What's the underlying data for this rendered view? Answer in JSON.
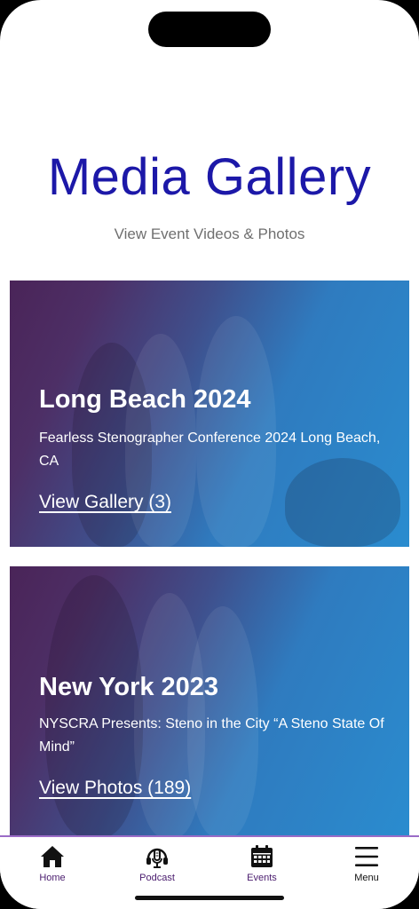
{
  "header": {
    "title": "Media Gallery",
    "subtitle": "View Event Videos & Photos"
  },
  "cards": [
    {
      "title": "Long Beach 2024",
      "description": "Fearless Stenographer Conference  2024 Long Beach, CA",
      "link_label": "View Gallery (3)"
    },
    {
      "title": "New York 2023",
      "description": "NYSCRA Presents: Steno in the City “A Steno State Of Mind”",
      "link_label": "View Photos (189)"
    }
  ],
  "tabbar": {
    "items": [
      {
        "label": "Home",
        "icon": "home-icon"
      },
      {
        "label": "Podcast",
        "icon": "podcast-icon"
      },
      {
        "label": "Events",
        "icon": "calendar-icon"
      },
      {
        "label": "Menu",
        "icon": "menu-icon"
      }
    ]
  },
  "colors": {
    "title": "#1c18a8",
    "tab_label": "#4a1c6e",
    "tab_border": "#9b6cc7",
    "card_gradient_start": "#4a2458",
    "card_gradient_end": "#2a8ccf"
  }
}
